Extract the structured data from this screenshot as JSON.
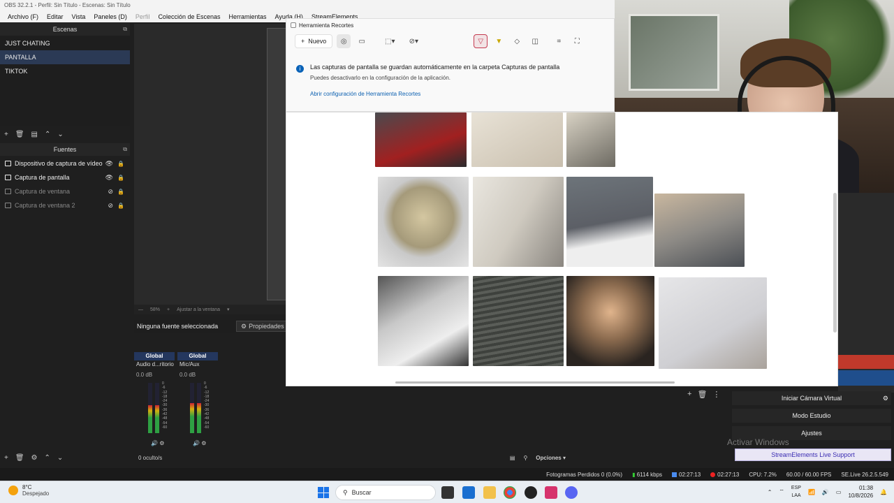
{
  "obs": {
    "title": "OBS 32.2.1 - Perfil: Sin Título - Escenas: Sin Título",
    "menu": [
      "Archivo (F)",
      "Editar",
      "Vista",
      "Paneles (D)",
      "Perfil",
      "Colección de Escenas",
      "Herramientas",
      "Ayuda (H)",
      "StreamElements"
    ],
    "scenes": {
      "header": "Escenas",
      "items": [
        "JUST CHATING",
        "PANTALLA",
        "TIKTOK"
      ],
      "selected": 1
    },
    "sources": {
      "header": "Fuentes",
      "items": [
        {
          "label": "Dispositivo de captura de vídeo",
          "visible": true
        },
        {
          "label": "Captura de pantalla",
          "visible": true
        },
        {
          "label": "Captura de ventana",
          "visible": false
        },
        {
          "label": "Captura de ventana 2",
          "visible": false
        }
      ]
    },
    "preview_bar": [
      "—",
      "58%",
      "+",
      "Ajustar a la ventana"
    ],
    "no_source": "Ninguna fuente seleccionada",
    "properties": "Propiedades",
    "mixer": {
      "channels": [
        {
          "head": "Global",
          "name": "Audio d...ritorio",
          "db": "0.0 dB",
          "level": 0.55
        },
        {
          "head": "Global",
          "name": "Mic/Aux",
          "db": "0.0 dB",
          "level": 0.6
        }
      ],
      "ticks": [
        "0",
        "-6",
        "-12",
        "-18",
        "-24",
        "-30",
        "-36",
        "-42",
        "-48",
        "-54",
        "-60"
      ],
      "hidden": "0 oculto/s",
      "options": "Opciones"
    },
    "controls": {
      "virtual_cam": "Iniciar Cámara Virtual",
      "studio": "Modo Estudio",
      "settings": "Ajustes",
      "activate": "Activar Windows",
      "se_support": "StreamElements Live Support"
    },
    "status": {
      "dropped": "Fotogramas Perdidos 0 (0.0%)",
      "bitrate": "6114 kbps",
      "live_time": "02:27:13",
      "rec_time": "02:27:13",
      "cpu": "CPU: 7.2%",
      "fps": "60.00 / 60.00 FPS",
      "version": "SE.Live 26.2.5.549"
    }
  },
  "snip": {
    "title": "Herramienta Recortes",
    "new": "Nuevo",
    "notice": "Las capturas de pantalla se guardan automáticamente en la carpeta Capturas de pantalla",
    "notice2": "Puedes desactivarlo en la configuración de la aplicación.",
    "link": "Abrir configuración de Herramienta Recortes",
    "accent": "#c43a50"
  },
  "taskbar": {
    "temp": "8°C",
    "weather": "Despejado",
    "search": "Buscar",
    "lang1": "ESP",
    "lang2": "LAA",
    "time": "01:38",
    "date": "10/8/2026"
  }
}
